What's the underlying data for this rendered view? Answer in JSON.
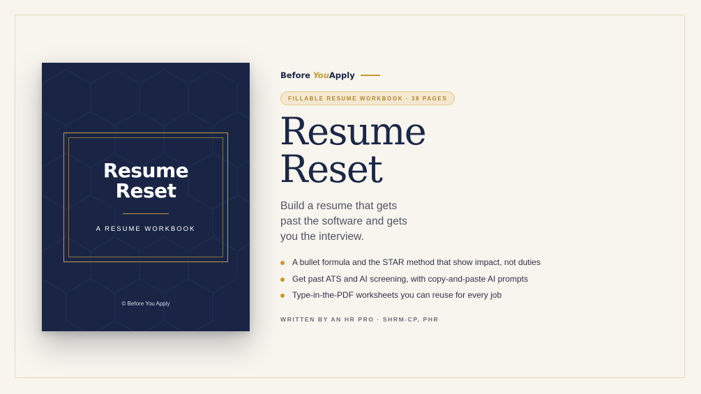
{
  "colors": {
    "background": "#f8f5ee",
    "navy": "#1a2545",
    "gold": "#c9982f",
    "frame_border": "#e6d8b8"
  },
  "cover": {
    "title_line1": "Resume",
    "title_line2": "Reset",
    "subtitle": "A RESUME WORKBOOK",
    "copyright": "© Before You Apply"
  },
  "brand": {
    "word1": "Before ",
    "word2": "You",
    "word3": "Apply"
  },
  "badge": "FILLABLE RESUME WORKBOOK · 38 PAGES",
  "headline": {
    "line1": "Resume",
    "line2": "Reset"
  },
  "subhead": "Build a resume that gets past the software and gets you the interview.",
  "bullets": [
    "A bullet formula and the STAR method that show impact, not duties",
    "Get past ATS and AI screening, with copy-and-paste AI prompts",
    "Type-in-the-PDF worksheets you can reuse for every job"
  ],
  "author": "WRITTEN BY AN HR PRO · SHRM-CP, PHR"
}
